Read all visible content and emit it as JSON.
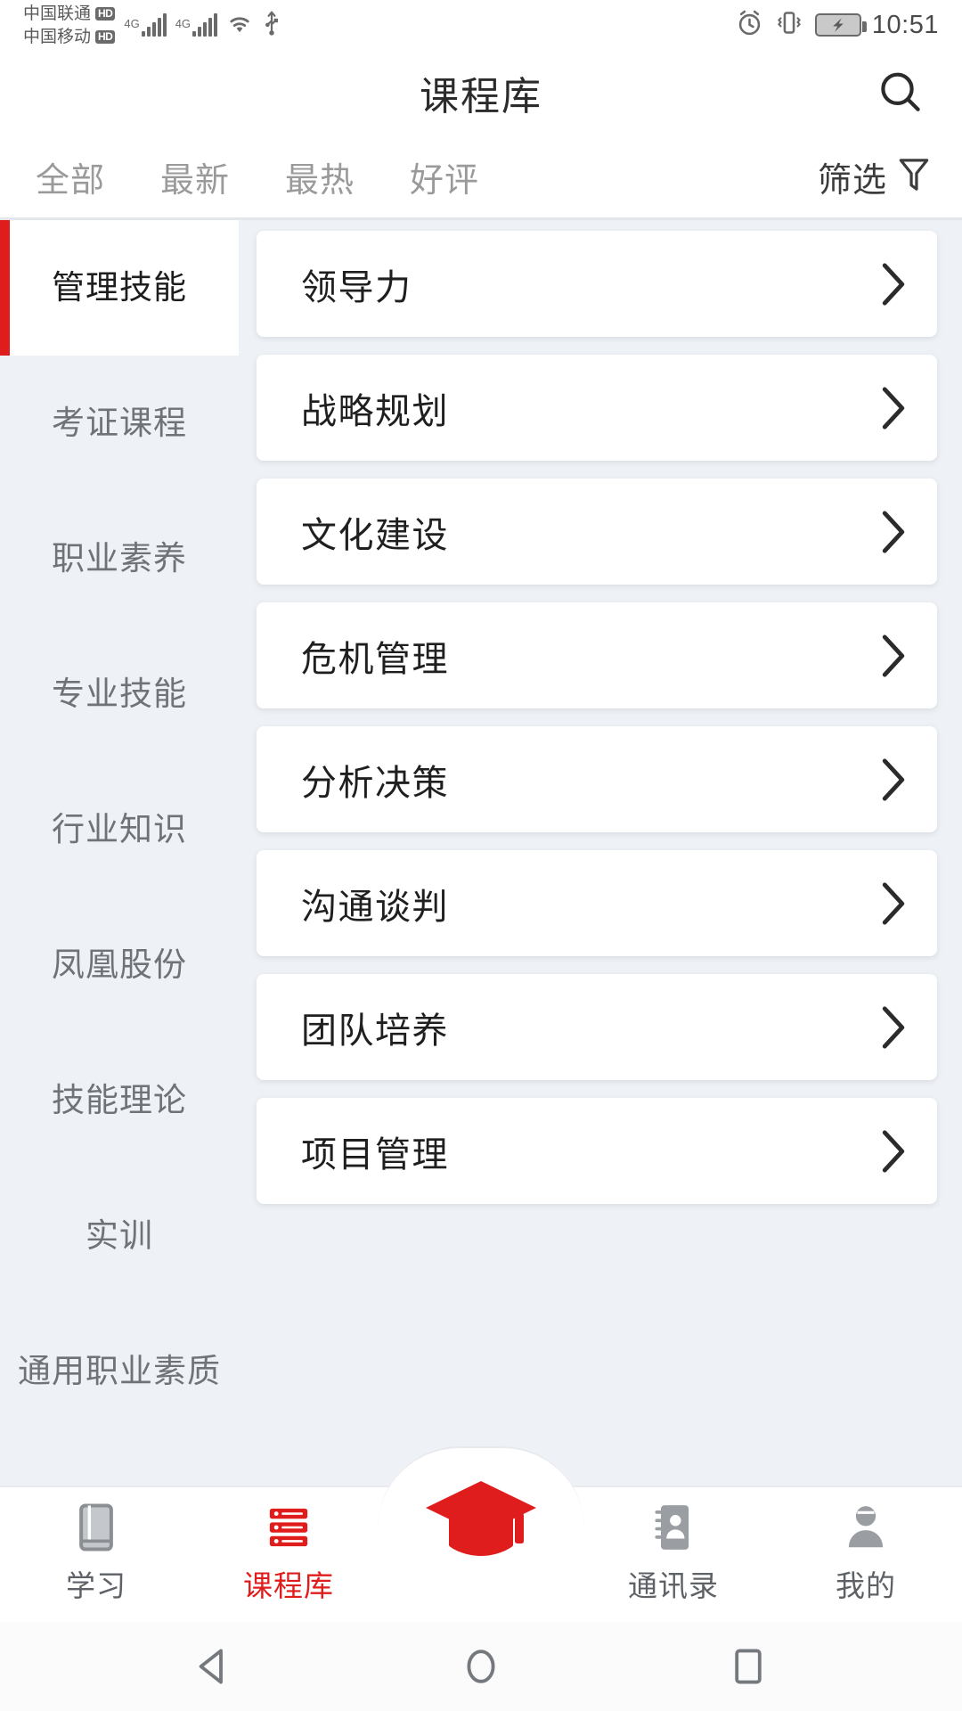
{
  "statusbar": {
    "carrier1": "中国联通",
    "carrier1_badge": "HD",
    "carrier2": "中国移动",
    "carrier2_badge": "HD",
    "network1": "4G",
    "network2": "4G",
    "wifi_icon": "wifi-icon",
    "usb_icon": "usb-icon",
    "alarm_icon": "alarm-clock-icon",
    "vibrate_icon": "vibrate-icon",
    "battery_icon": "battery-charging-icon",
    "time": "10:51"
  },
  "header": {
    "title": "课程库",
    "search_icon": "search-icon"
  },
  "tabs": {
    "items": [
      {
        "label": "全部",
        "active": true
      },
      {
        "label": "最新",
        "active": false
      },
      {
        "label": "最热",
        "active": false
      },
      {
        "label": "好评",
        "active": false
      }
    ],
    "filter_label": "筛选",
    "filter_icon": "funnel-icon"
  },
  "sidebar": {
    "items": [
      {
        "label": "管理技能",
        "active": true
      },
      {
        "label": "考证课程",
        "active": false
      },
      {
        "label": "职业素养",
        "active": false
      },
      {
        "label": "专业技能",
        "active": false
      },
      {
        "label": "行业知识",
        "active": false
      },
      {
        "label": "凤凰股份",
        "active": false
      },
      {
        "label": "技能理论",
        "active": false
      },
      {
        "label": "实训",
        "active": false
      },
      {
        "label": "通用职业素质",
        "active": false
      }
    ]
  },
  "courses": {
    "chevron_icon": "chevron-right-icon",
    "items": [
      {
        "title": "领导力"
      },
      {
        "title": "战略规划"
      },
      {
        "title": "文化建设"
      },
      {
        "title": "危机管理"
      },
      {
        "title": "分析决策"
      },
      {
        "title": "沟通谈判"
      },
      {
        "title": "团队培养"
      },
      {
        "title": "项目管理"
      }
    ]
  },
  "bottomnav": {
    "items": [
      {
        "label": "学习",
        "icon": "book-icon",
        "active": false
      },
      {
        "label": "课程库",
        "icon": "course-stack-icon",
        "active": true
      },
      {
        "label": "",
        "icon": "graduation-cap-icon",
        "active": false
      },
      {
        "label": "通讯录",
        "icon": "contacts-icon",
        "active": false
      },
      {
        "label": "我的",
        "icon": "person-icon",
        "active": false
      }
    ]
  },
  "androidnav": {
    "back_icon": "back-triangle-icon",
    "home_icon": "home-circle-icon",
    "recents_icon": "recents-square-icon"
  },
  "colors": {
    "accent": "#e01d1d",
    "page_bg": "#eef1f5",
    "card_bg": "#ffffff",
    "text_primary": "#1f1f1f",
    "text_muted": "#9a9a9a"
  }
}
